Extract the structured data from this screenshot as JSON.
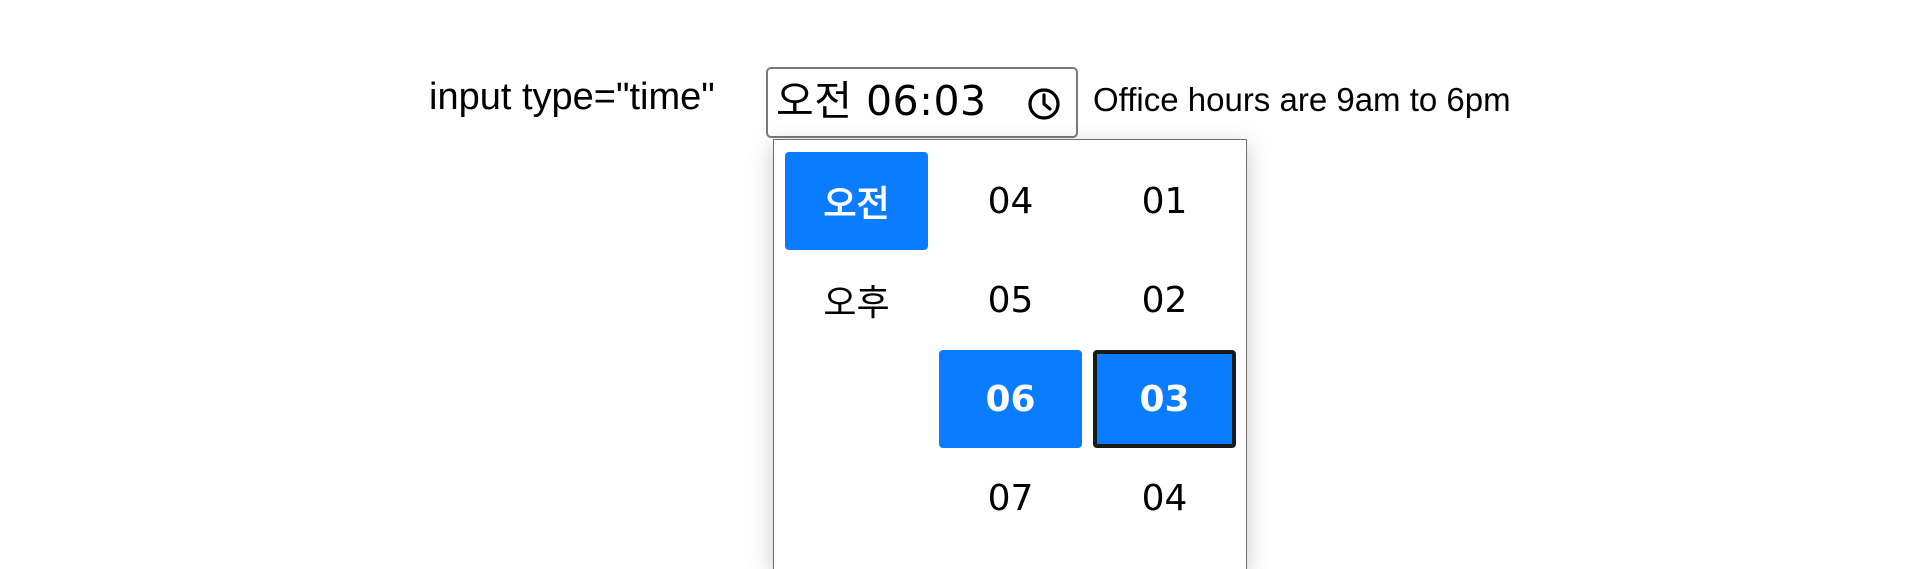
{
  "field": {
    "label": "input type=\"time\"",
    "value": "오전 06:03",
    "icon": "clock-icon",
    "hint": "Office hours are 9am to 6pm"
  },
  "picker": {
    "ampm": [
      "오전",
      "오후"
    ],
    "ampm_selected": "오전",
    "hours": [
      "04",
      "05",
      "06",
      "07"
    ],
    "hour_selected": "06",
    "minutes": [
      "01",
      "02",
      "03",
      "04"
    ],
    "minute_selected": "03",
    "focused_column": "minutes"
  },
  "colors": {
    "accent": "#0a7cff",
    "focus_border": "#1a1a1a"
  }
}
